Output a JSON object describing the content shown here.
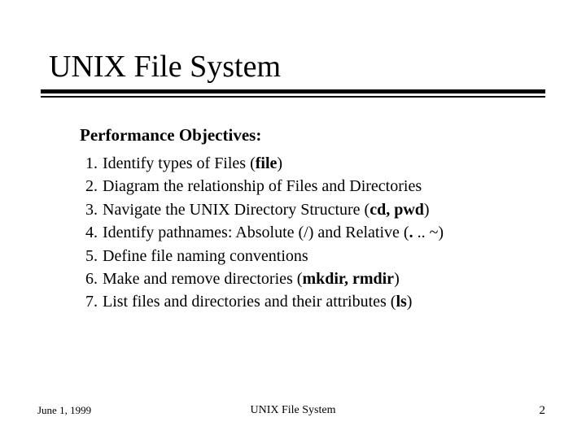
{
  "title": "UNIX File System",
  "subhead": "Performance Objectives:",
  "objectives": [
    {
      "num": "1.",
      "pre": "Identify types of Files  (",
      "bold": "file",
      "post": ")"
    },
    {
      "num": "2.",
      "pre": "Diagram the relationship of Files and Directories",
      "bold": "",
      "post": ""
    },
    {
      "num": "3.",
      "pre": "Navigate the UNIX Directory Structure  (",
      "bold": "cd, pwd",
      "post": ")"
    },
    {
      "num": "4.",
      "pre": "Identify pathnames: Absolute (/) and Relative  (",
      "bold": ".",
      "post": " .. ~)"
    },
    {
      "num": "5.",
      "pre": "Define file naming conventions",
      "bold": "",
      "post": ""
    },
    {
      "num": "6.",
      "pre": "Make and remove directories  (",
      "bold": "mkdir, rmdir",
      "post": ")"
    },
    {
      "num": "7.",
      "pre": "List files and directories and their attributes  (",
      "bold": "ls",
      "post": ")"
    }
  ],
  "footer": {
    "date": "June 1, 1999",
    "center": "UNIX File System",
    "page": "2"
  }
}
